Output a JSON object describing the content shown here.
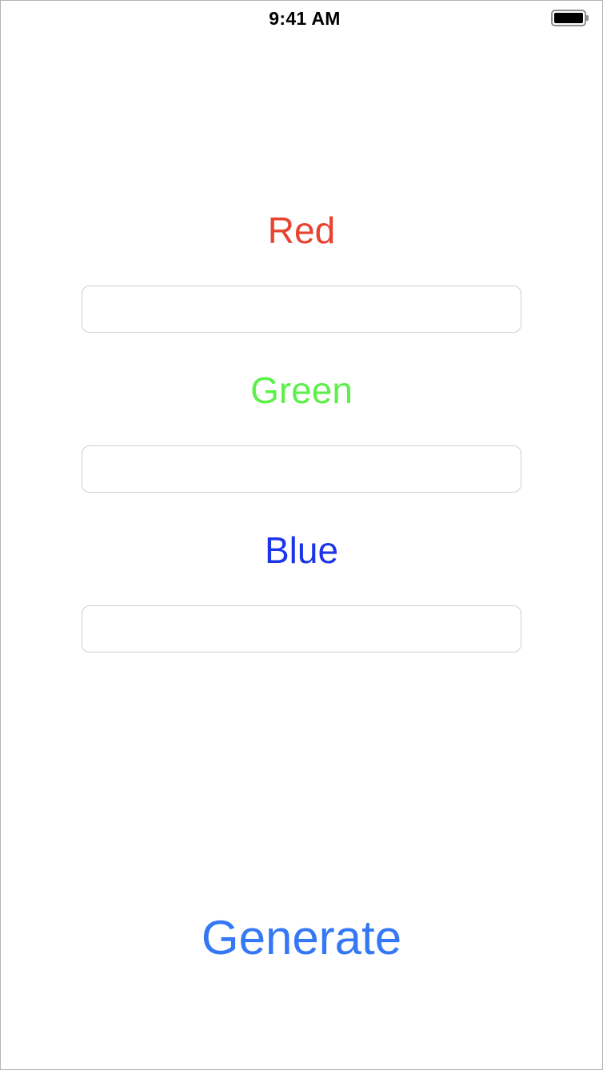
{
  "status_bar": {
    "time": "9:41 AM",
    "battery_icon": "battery-full-icon"
  },
  "form": {
    "fields": [
      {
        "label": "Red",
        "value": "",
        "placeholder": "",
        "color": "#e8432f"
      },
      {
        "label": "Green",
        "value": "",
        "placeholder": "",
        "color": "#5df04b"
      },
      {
        "label": "Blue",
        "value": "",
        "placeholder": "",
        "color": "#1d35e8"
      }
    ]
  },
  "actions": {
    "generate_label": "Generate",
    "generate_color": "#3478f6"
  },
  "colors": {
    "background": "#ffffff",
    "field_border": "#cfcfcf",
    "frame_border": "#b3b3b3"
  }
}
